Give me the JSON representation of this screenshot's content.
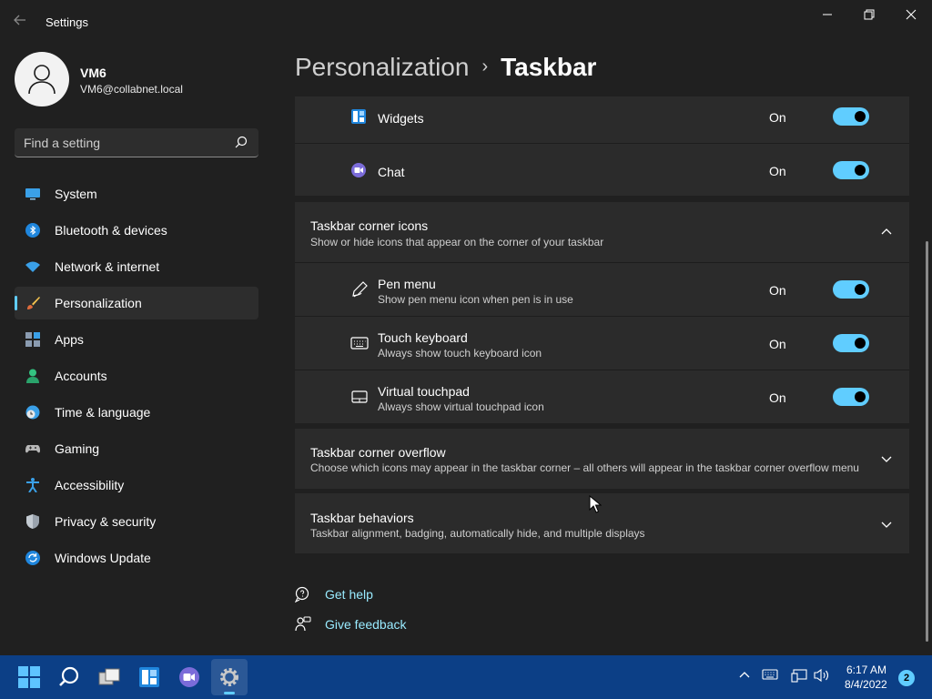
{
  "window": {
    "title": "Settings",
    "back_icon": "back-arrow-icon",
    "controls": [
      "minimize-icon",
      "restore-icon",
      "close-icon"
    ]
  },
  "profile": {
    "name": "VM6",
    "email": "VM6@collabnet.local"
  },
  "search": {
    "placeholder": "Find a setting"
  },
  "sidebar": {
    "items": [
      {
        "label": "System",
        "icon": "system-monitor-icon"
      },
      {
        "label": "Bluetooth & devices",
        "icon": "bluetooth-icon"
      },
      {
        "label": "Network & internet",
        "icon": "wifi-icon"
      },
      {
        "label": "Personalization",
        "icon": "brush-icon",
        "selected": true
      },
      {
        "label": "Apps",
        "icon": "apps-icon"
      },
      {
        "label": "Accounts",
        "icon": "account-icon"
      },
      {
        "label": "Time & language",
        "icon": "clock-globe-icon"
      },
      {
        "label": "Gaming",
        "icon": "gamepad-icon"
      },
      {
        "label": "Accessibility",
        "icon": "accessibility-icon"
      },
      {
        "label": "Privacy & security",
        "icon": "shield-icon"
      },
      {
        "label": "Windows Update",
        "icon": "update-icon"
      }
    ]
  },
  "breadcrumb": {
    "parent": "Personalization",
    "separator": "›",
    "current": "Taskbar"
  },
  "taskbar_items": [
    {
      "label": "Widgets",
      "state": "On",
      "icon": "widgets-icon"
    },
    {
      "label": "Chat",
      "state": "On",
      "icon": "chat-icon"
    }
  ],
  "corner_icons": {
    "title": "Taskbar corner icons",
    "subtitle": "Show or hide icons that appear on the corner of your taskbar",
    "items": [
      {
        "label": "Pen menu",
        "subtitle": "Show pen menu icon when pen is in use",
        "state": "On",
        "icon": "pen-icon"
      },
      {
        "label": "Touch keyboard",
        "subtitle": "Always show touch keyboard icon",
        "state": "On",
        "icon": "keyboard-icon"
      },
      {
        "label": "Virtual touchpad",
        "subtitle": "Always show virtual touchpad icon",
        "state": "On",
        "icon": "touchpad-icon"
      }
    ]
  },
  "corner_overflow": {
    "title": "Taskbar corner overflow",
    "subtitle": "Choose which icons may appear in the taskbar corner – all others will appear in the taskbar corner overflow menu"
  },
  "behaviors": {
    "title": "Taskbar behaviors",
    "subtitle": "Taskbar alignment, badging, automatically hide, and multiple displays"
  },
  "links": {
    "help": "Get help",
    "feedback": "Give feedback"
  },
  "system_taskbar": {
    "time": "6:17 AM",
    "date": "8/4/2022",
    "notifications": "2"
  },
  "colors": {
    "accent": "#60cdff",
    "background": "#202020",
    "card": "#2b2b2b",
    "taskbar": "#0c3f86"
  }
}
